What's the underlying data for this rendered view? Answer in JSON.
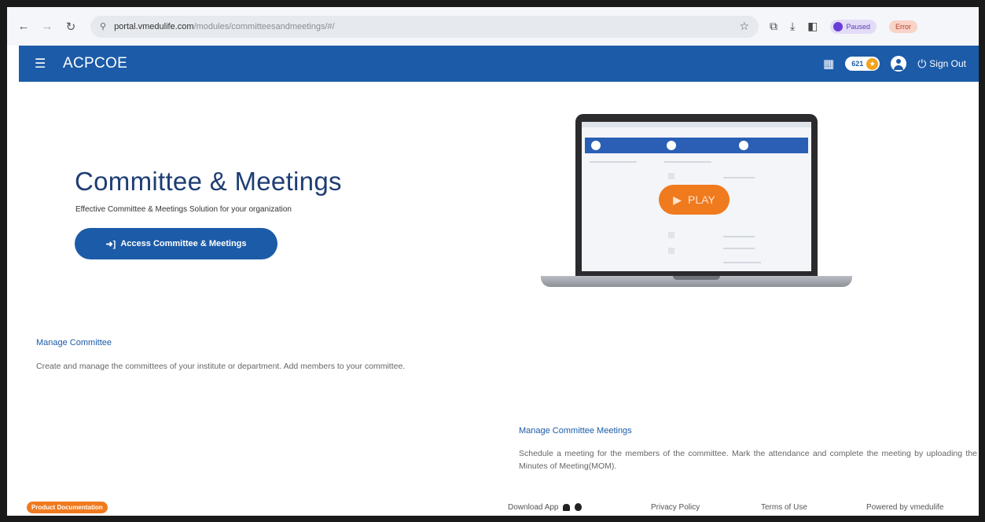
{
  "browser": {
    "url_host": "portal.vmedulife.com",
    "url_path": "/modules/committeesandmeetings/#/",
    "profile_label": "Paused",
    "error_label": "Error"
  },
  "header": {
    "app_title": "ACPCOE",
    "points": "621",
    "signout_label": "Sign Out",
    "brand_color": "#1c5ba8"
  },
  "hero": {
    "title": "Committee & Meetings",
    "subtitle": "Effective Committee & Meetings Solution for your organization",
    "access_button": "Access Committee & Meetings",
    "play_label": "PLAY"
  },
  "features": [
    {
      "title": "Manage Committee",
      "description": "Create and manage the committees of your institute or department. Add members to your committee."
    },
    {
      "title": "Manage Committee Meetings",
      "description": "Schedule a meeting for the members of the committee. Mark the attendance and complete the meeting by uploading the Minutes of Meeting(MOM)."
    }
  ],
  "footer": {
    "product_doc": "Product Documentation",
    "download_app": "Download App",
    "privacy": "Privacy Policy",
    "terms": "Terms of Use",
    "powered_by": "Powered by vmedulife"
  },
  "icons": {
    "back": "back-arrow-icon",
    "forward": "forward-arrow-icon",
    "reload": "reload-icon",
    "menu": "hamburger-menu-icon",
    "apps": "apps-grid-icon",
    "user": "user-account-icon",
    "power": "power-icon",
    "play": "play-icon"
  },
  "colors": {
    "accent_orange": "#f07a1e",
    "title_navy": "#1e3d73"
  }
}
